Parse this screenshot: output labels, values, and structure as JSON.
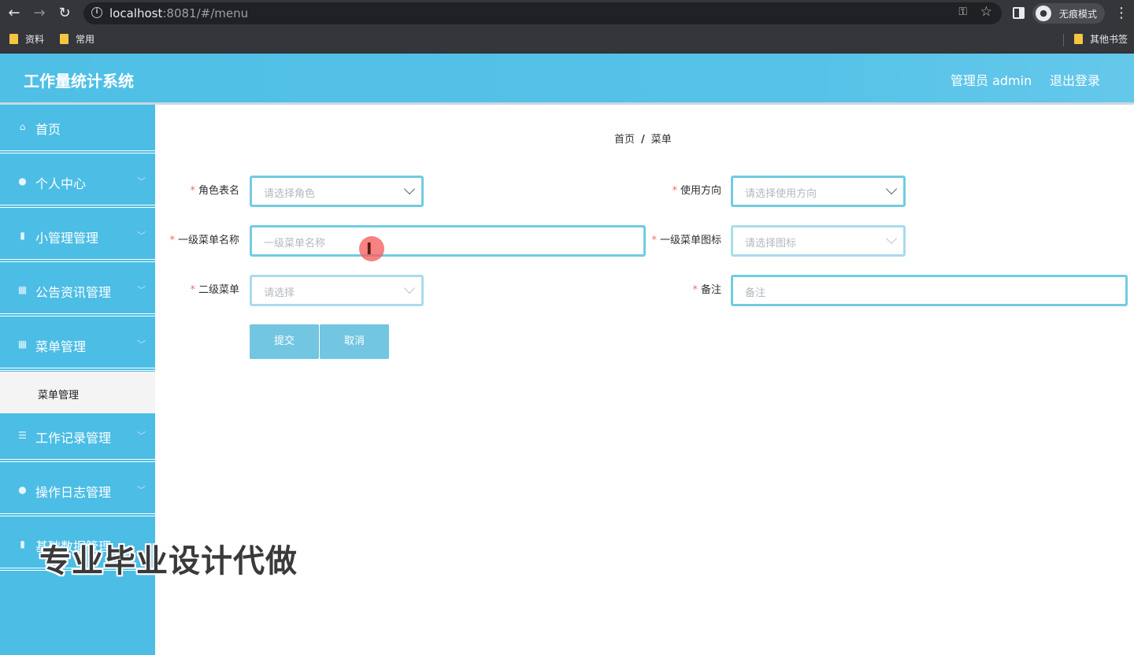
{
  "browser": {
    "url_host": "localhost",
    "url_rest": ":8081/#/menu",
    "incognito_label": "无痕模式",
    "bookmarks": [
      "资料",
      "常用"
    ],
    "other_bookmarks": "其他书签"
  },
  "header": {
    "title": "工作量统计系统",
    "user": "管理员 admin",
    "logout": "退出登录"
  },
  "sidebar": {
    "items": [
      {
        "label": "首页",
        "icon": "home-icon"
      },
      {
        "label": "个人中心",
        "icon": "user-icon"
      },
      {
        "label": "小管理管理",
        "icon": "clipboard-icon"
      },
      {
        "label": "公告资讯管理",
        "icon": "grid-icon"
      },
      {
        "label": "菜单管理",
        "icon": "grid-icon"
      },
      {
        "label": "工作记录管理",
        "icon": "list-icon"
      },
      {
        "label": "操作日志管理",
        "icon": "user-icon"
      },
      {
        "label": "基础数据管理",
        "icon": "clipboard-icon"
      }
    ],
    "active_submenu": "菜单管理"
  },
  "breadcrumb": {
    "home": "首页",
    "separator": "/",
    "current": "菜单"
  },
  "form": {
    "role_label": "角色表名",
    "role_placeholder": "请选择角色",
    "direction_label": "使用方向",
    "direction_placeholder": "请选择使用方向",
    "menu1_name_label": "一级菜单名称",
    "menu1_name_placeholder": "一级菜单名称",
    "menu1_icon_label": "一级菜单图标",
    "menu1_icon_placeholder": "请选择图标",
    "menu2_label": "二级菜单",
    "menu2_placeholder": "请选择",
    "remark_label": "备注",
    "remark_placeholder": "备注",
    "required_mark": "*",
    "submit": "提交",
    "cancel": "取消"
  },
  "overlay": {
    "watermark": "专业毕业设计代做"
  },
  "colors": {
    "accent": "#4cbde5",
    "required": "#f56c6c",
    "button": "#72c6e1"
  }
}
